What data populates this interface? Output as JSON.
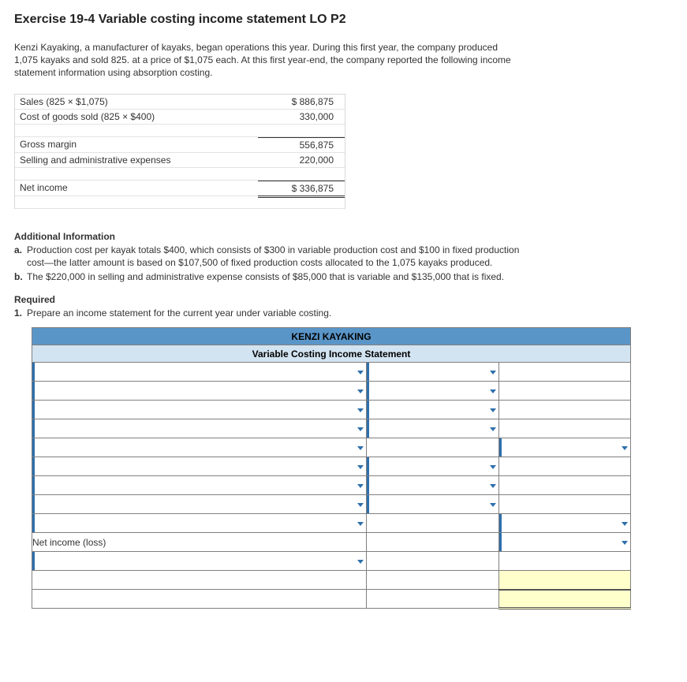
{
  "title": "Exercise 19-4 Variable costing income statement LO P2",
  "intro": "Kenzi Kayaking, a manufacturer of kayaks, began operations this year. During this first year, the company produced 1,075 kayaks and sold 825. at a price of $1,075 each. At this first year-end, the company reported the following income statement information using absorption costing.",
  "absorption": {
    "rows": [
      {
        "label": "Sales (825 × $1,075)",
        "value": "$ 886,875"
      },
      {
        "label": "Cost of goods sold (825 × $400)",
        "value": "330,000"
      },
      {
        "label": "Gross margin",
        "value": "556,875"
      },
      {
        "label": "Selling and administrative expenses",
        "value": "220,000"
      },
      {
        "label": "Net income",
        "value": "$ 336,875"
      }
    ]
  },
  "addl_head": "Additional Information",
  "addl": [
    {
      "letter": "a.",
      "text": "Production cost per kayak totals $400, which consists of $300 in variable production cost and $100 in fixed production cost—the latter amount is based on $107,500 of fixed production costs allocated to the 1,075 kayaks produced."
    },
    {
      "letter": "b.",
      "text": "The $220,000 in selling and administrative expense consists of $85,000 that is variable and $135,000 that is fixed."
    }
  ],
  "req_head": "Required",
  "req_text": "Prepare an income statement for the current year under variable costing.",
  "req_num": "1.",
  "worksheet": {
    "header1": "KENZI KAYAKING",
    "header2": "Variable Costing Income Statement",
    "net_income_label": "Net income (loss)"
  }
}
